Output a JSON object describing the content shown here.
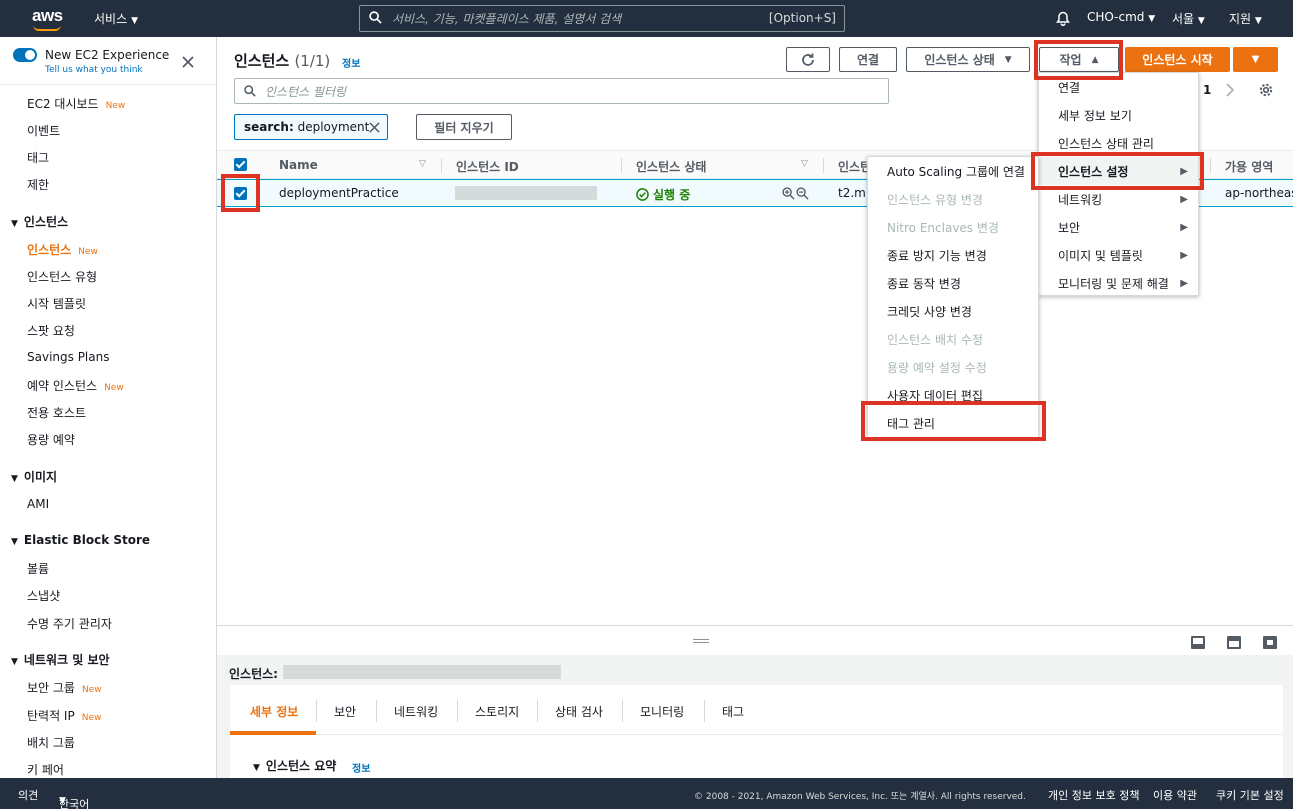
{
  "topnav": {
    "logo": "aws",
    "services_label": "서비스",
    "search_placeholder": "서비스, 기능, 마켓플레이스 제품, 설명서 검색",
    "search_shortcut": "[Option+S]",
    "account": "CHO-cmd",
    "region": "서울",
    "support": "지원"
  },
  "sidebar": {
    "experience_title": "New EC2 Experience",
    "experience_sub": "Tell us what you think",
    "new_badge": "New",
    "items_top": [
      "EC2 대시보드",
      "이벤트",
      "태그",
      "제한"
    ],
    "section_instances": "인스턴스",
    "items_instances": [
      "인스턴스",
      "인스턴스 유형",
      "시작 템플릿",
      "스팟 요청",
      "Savings Plans",
      "예약 인스턴스",
      "전용 호스트",
      "용량 예약"
    ],
    "section_images": "이미지",
    "items_images": [
      "AMI"
    ],
    "section_ebs": "Elastic Block Store",
    "items_ebs": [
      "볼륨",
      "스냅샷",
      "수명 주기 관리자"
    ],
    "section_network": "네트워크 및 보안",
    "items_network": [
      "보안 그룹",
      "탄력적 IP",
      "배치 그룹",
      "키 페어"
    ]
  },
  "main": {
    "title": "인스턴스",
    "count": "(1/1)",
    "info": "정보",
    "refresh_icon": "refresh-icon",
    "connect_button": "연결",
    "state_button": "인스턴스 상태",
    "actions_button": "작업",
    "launch_button": "인스턴스 시작",
    "filter_placeholder": "인스턴스 필터링",
    "filter_token_key": "search:",
    "filter_token_value": "deployment",
    "clear_filters": "필터 지우기",
    "page_number": "1",
    "columns": [
      "Name",
      "인스턴스 ID",
      "인스턴스 상태",
      "인스턴",
      "가용 영역"
    ],
    "row": {
      "name": "deploymentPractice",
      "state": "실행 중",
      "type": "t2.mi",
      "az": "ap-northeas"
    }
  },
  "actions_menu": {
    "items": [
      "연결",
      "세부 정보 보기",
      "인스턴스 상태 관리",
      "인스턴스 설정",
      "네트워킹",
      "보안",
      "이미지 및 템플릿",
      "모니터링 및 문제 해결"
    ]
  },
  "settings_submenu": {
    "items": [
      "Auto Scaling 그룹에 연결",
      "인스턴스 유형 변경",
      "Nitro Enclaves 변경",
      "종료 방지 기능 변경",
      "종료 동작 변경",
      "크레딧 사양 변경",
      "인스턴스 배치 수정",
      "용량 예약 설정 수정",
      "사용자 데이터 편집",
      "태그 관리"
    ]
  },
  "bottom": {
    "title": "인스턴스:",
    "tabs": [
      "세부 정보",
      "보안",
      "네트워킹",
      "스토리지",
      "상태 검사",
      "모니터링",
      "태그"
    ],
    "summary_title": "인스턴스 요약",
    "summary_info": "정보"
  },
  "footer": {
    "feedback": "의견",
    "language": "한국어",
    "copyright": "© 2008 - 2021, Amazon Web Services, Inc. 또는 계열사. All rights reserved.",
    "privacy": "개인 정보 보호 정책",
    "terms": "이용 약관",
    "cookies": "쿠키 기본 설정"
  },
  "colors": {
    "nav_bg": "#232f3e",
    "accent_orange": "#ec7211",
    "link_blue": "#0073bb",
    "highlight_red": "#dd3322",
    "running_green": "#1d8102"
  }
}
